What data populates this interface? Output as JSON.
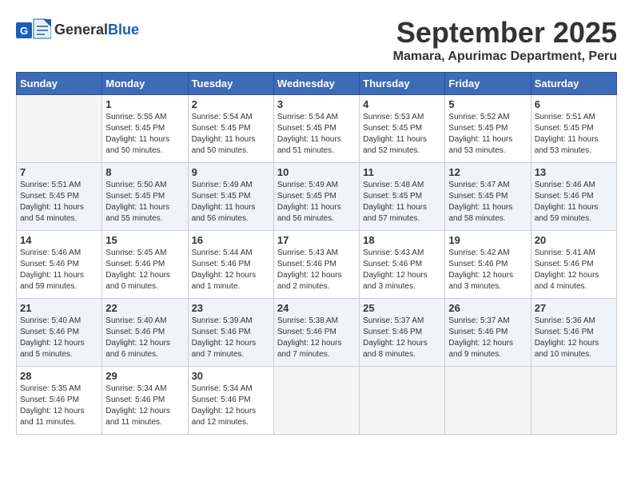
{
  "header": {
    "logo_general": "General",
    "logo_blue": "Blue",
    "month_title": "September 2025",
    "subtitle": "Mamara, Apurimac Department, Peru"
  },
  "days_of_week": [
    "Sunday",
    "Monday",
    "Tuesday",
    "Wednesday",
    "Thursday",
    "Friday",
    "Saturday"
  ],
  "weeks": [
    [
      {
        "day": "",
        "info": ""
      },
      {
        "day": "1",
        "info": "Sunrise: 5:55 AM\nSunset: 5:45 PM\nDaylight: 11 hours\nand 50 minutes."
      },
      {
        "day": "2",
        "info": "Sunrise: 5:54 AM\nSunset: 5:45 PM\nDaylight: 11 hours\nand 50 minutes."
      },
      {
        "day": "3",
        "info": "Sunrise: 5:54 AM\nSunset: 5:45 PM\nDaylight: 11 hours\nand 51 minutes."
      },
      {
        "day": "4",
        "info": "Sunrise: 5:53 AM\nSunset: 5:45 PM\nDaylight: 11 hours\nand 52 minutes."
      },
      {
        "day": "5",
        "info": "Sunrise: 5:52 AM\nSunset: 5:45 PM\nDaylight: 11 hours\nand 53 minutes."
      },
      {
        "day": "6",
        "info": "Sunrise: 5:51 AM\nSunset: 5:45 PM\nDaylight: 11 hours\nand 53 minutes."
      }
    ],
    [
      {
        "day": "7",
        "info": "Sunrise: 5:51 AM\nSunset: 5:45 PM\nDaylight: 11 hours\nand 54 minutes."
      },
      {
        "day": "8",
        "info": "Sunrise: 5:50 AM\nSunset: 5:45 PM\nDaylight: 11 hours\nand 55 minutes."
      },
      {
        "day": "9",
        "info": "Sunrise: 5:49 AM\nSunset: 5:45 PM\nDaylight: 11 hours\nand 56 minutes."
      },
      {
        "day": "10",
        "info": "Sunrise: 5:49 AM\nSunset: 5:45 PM\nDaylight: 11 hours\nand 56 minutes."
      },
      {
        "day": "11",
        "info": "Sunrise: 5:48 AM\nSunset: 5:45 PM\nDaylight: 11 hours\nand 57 minutes."
      },
      {
        "day": "12",
        "info": "Sunrise: 5:47 AM\nSunset: 5:45 PM\nDaylight: 11 hours\nand 58 minutes."
      },
      {
        "day": "13",
        "info": "Sunrise: 5:46 AM\nSunset: 5:46 PM\nDaylight: 11 hours\nand 59 minutes."
      }
    ],
    [
      {
        "day": "14",
        "info": "Sunrise: 5:46 AM\nSunset: 5:46 PM\nDaylight: 11 hours\nand 59 minutes."
      },
      {
        "day": "15",
        "info": "Sunrise: 5:45 AM\nSunset: 5:46 PM\nDaylight: 12 hours\nand 0 minutes."
      },
      {
        "day": "16",
        "info": "Sunrise: 5:44 AM\nSunset: 5:46 PM\nDaylight: 12 hours\nand 1 minute."
      },
      {
        "day": "17",
        "info": "Sunrise: 5:43 AM\nSunset: 5:46 PM\nDaylight: 12 hours\nand 2 minutes."
      },
      {
        "day": "18",
        "info": "Sunrise: 5:43 AM\nSunset: 5:46 PM\nDaylight: 12 hours\nand 3 minutes."
      },
      {
        "day": "19",
        "info": "Sunrise: 5:42 AM\nSunset: 5:46 PM\nDaylight: 12 hours\nand 3 minutes."
      },
      {
        "day": "20",
        "info": "Sunrise: 5:41 AM\nSunset: 5:46 PM\nDaylight: 12 hours\nand 4 minutes."
      }
    ],
    [
      {
        "day": "21",
        "info": "Sunrise: 5:40 AM\nSunset: 5:46 PM\nDaylight: 12 hours\nand 5 minutes."
      },
      {
        "day": "22",
        "info": "Sunrise: 5:40 AM\nSunset: 5:46 PM\nDaylight: 12 hours\nand 6 minutes."
      },
      {
        "day": "23",
        "info": "Sunrise: 5:39 AM\nSunset: 5:46 PM\nDaylight: 12 hours\nand 7 minutes."
      },
      {
        "day": "24",
        "info": "Sunrise: 5:38 AM\nSunset: 5:46 PM\nDaylight: 12 hours\nand 7 minutes."
      },
      {
        "day": "25",
        "info": "Sunrise: 5:37 AM\nSunset: 5:46 PM\nDaylight: 12 hours\nand 8 minutes."
      },
      {
        "day": "26",
        "info": "Sunrise: 5:37 AM\nSunset: 5:46 PM\nDaylight: 12 hours\nand 9 minutes."
      },
      {
        "day": "27",
        "info": "Sunrise: 5:36 AM\nSunset: 5:46 PM\nDaylight: 12 hours\nand 10 minutes."
      }
    ],
    [
      {
        "day": "28",
        "info": "Sunrise: 5:35 AM\nSunset: 5:46 PM\nDaylight: 12 hours\nand 11 minutes."
      },
      {
        "day": "29",
        "info": "Sunrise: 5:34 AM\nSunset: 5:46 PM\nDaylight: 12 hours\nand 11 minutes."
      },
      {
        "day": "30",
        "info": "Sunrise: 5:34 AM\nSunset: 5:46 PM\nDaylight: 12 hours\nand 12 minutes."
      },
      {
        "day": "",
        "info": ""
      },
      {
        "day": "",
        "info": ""
      },
      {
        "day": "",
        "info": ""
      },
      {
        "day": "",
        "info": ""
      }
    ]
  ]
}
